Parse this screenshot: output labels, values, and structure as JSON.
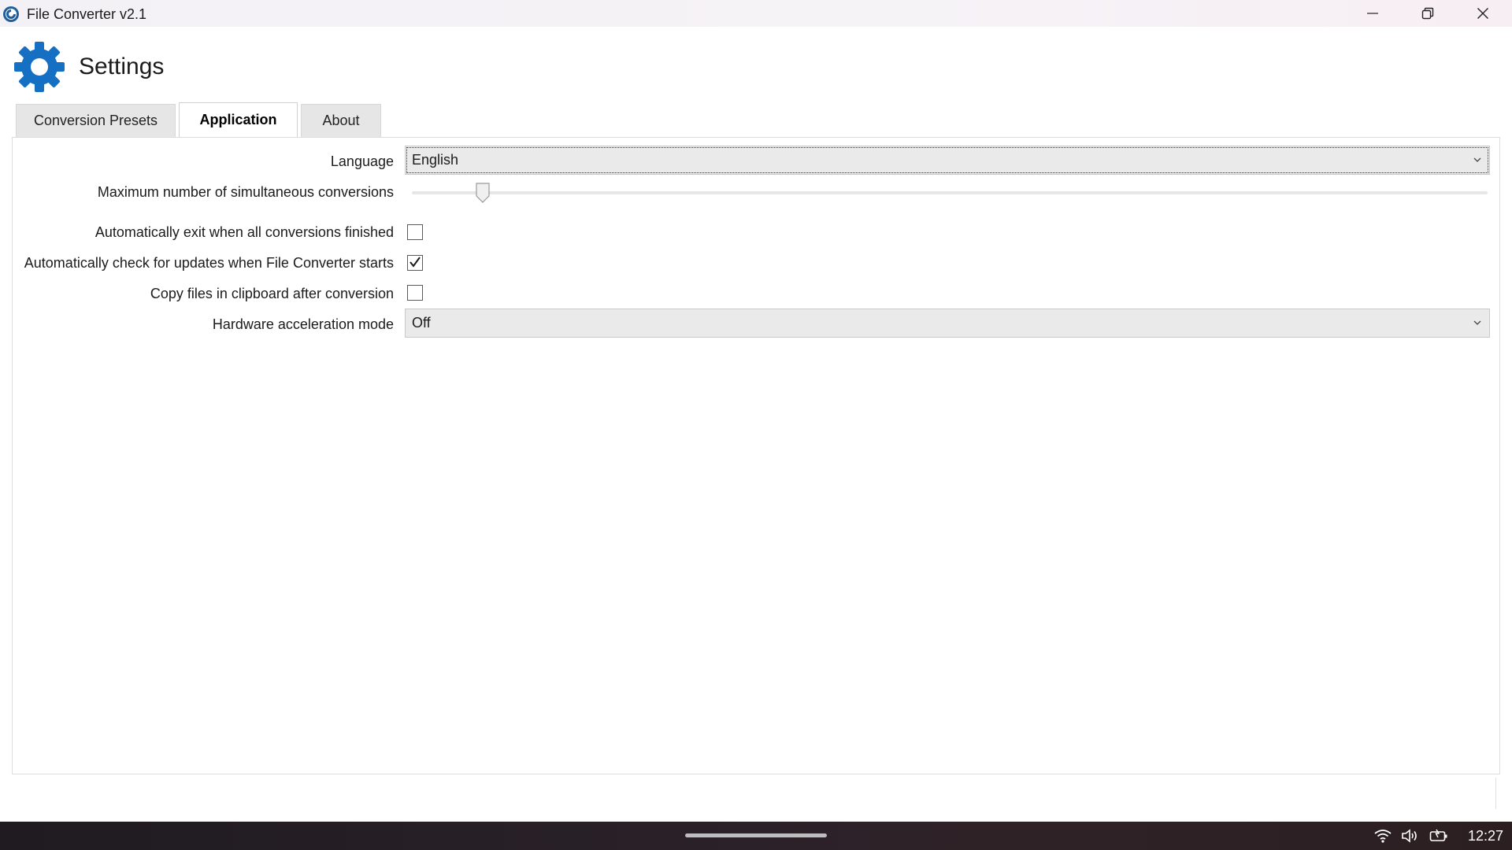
{
  "window": {
    "title": "File Converter v2.1",
    "icons": {
      "app": "file-converter-logo-icon",
      "minimize": "minimize-icon",
      "maximize": "restore-icon",
      "close": "close-icon"
    }
  },
  "header": {
    "title": "Settings",
    "icon": "gear-icon",
    "accent_color": "#1570c4"
  },
  "tabs": [
    {
      "label": "Conversion Presets",
      "selected": false
    },
    {
      "label": "Application",
      "selected": true
    },
    {
      "label": "About",
      "selected": false
    }
  ],
  "settings": {
    "language": {
      "label": "Language",
      "value": "English"
    },
    "max_conversions": {
      "label": "Maximum number of simultaneous conversions",
      "slider_fraction": 0.06
    },
    "auto_exit": {
      "label": "Automatically exit when all conversions finished",
      "checked": false
    },
    "check_updates": {
      "label": "Automatically check for updates when File Converter starts",
      "checked": true
    },
    "copy_clipboard": {
      "label": "Copy files in clipboard after conversion",
      "checked": false
    },
    "hw_accel": {
      "label": "Hardware acceleration mode",
      "value": "Off"
    }
  },
  "taskbar": {
    "time": "12:27",
    "icons": [
      "wifi-icon",
      "volume-icon",
      "battery-icon"
    ]
  }
}
